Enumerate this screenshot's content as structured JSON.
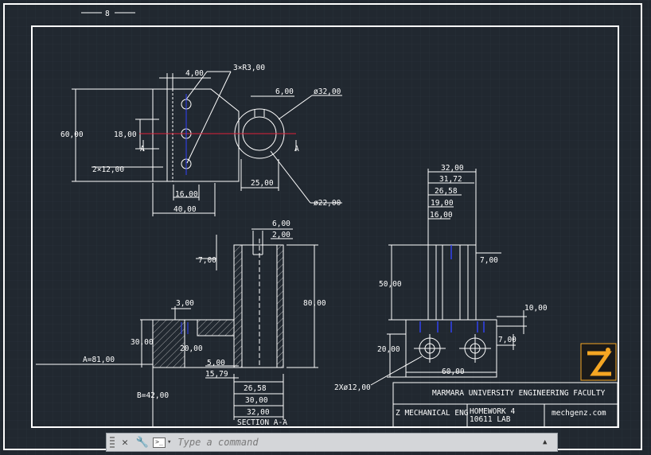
{
  "drawing": {
    "top_tab": "8",
    "top_view": {
      "radii_note": "3×R3,00",
      "dim_width_top": "4,00",
      "dim_slot": "6,00",
      "dim_dia_outer": "ø32,00",
      "dim_dia_inner": "ø22,00",
      "dim_height": "60,00",
      "dim_center": "18,00",
      "dim_holes": "2×12,00",
      "dim_base": "16,00",
      "dim_width": "40,00",
      "dim_boss": "25,00",
      "section_mark_left": "A",
      "section_mark_right": "A"
    },
    "section_view": {
      "dim_top_slot": "6,00",
      "dim_wall": "2,00",
      "dim_left_step": "7,00",
      "dim_height": "80,00",
      "dim_ledge": "3,00",
      "dim_base_h": "30,00",
      "dim_hole_h": "20,00",
      "dim_a": "A=81,00",
      "dim_5": "5,00",
      "dim_1579": "15,79",
      "dim_2658": "26,58",
      "dim_30": "30,00",
      "dim_32": "32,00",
      "dim_b": "B=42,00",
      "label": "SECTION A-A"
    },
    "side_view": {
      "dim_32": "32,00",
      "dim_3172": "31,72",
      "dim_2658": "26,58",
      "dim_19": "19,00",
      "dim_16": "16,00",
      "dim_7_right": "7,00",
      "dim_50": "50,00",
      "dim_10": "10,00",
      "dim_7_small": "7,00",
      "dim_20": "20,00",
      "dim_60": "60,00",
      "dim_holes": "2Xø12,00"
    },
    "title_block": {
      "faculty": "MARMARA UNIVERSITY ENGINEERING FACULTY",
      "department": "Z MECHANICAL ENG",
      "homework": "HOMEWORK 4",
      "lab": "10611 LAB",
      "website": "mechgenz.com"
    }
  },
  "command_line": {
    "placeholder": "Type a command",
    "close_glyph": "✕",
    "settings_glyph": "🔧",
    "prompt_glyph": ">_",
    "arrow_glyph": "▲"
  },
  "colors": {
    "background": "#212830",
    "line": "#ffffff",
    "hatch": "#cfcfcf",
    "centerline_red": "#e0203a",
    "hidden_blue": "#3344ff",
    "logo_orange": "#f5a623"
  }
}
